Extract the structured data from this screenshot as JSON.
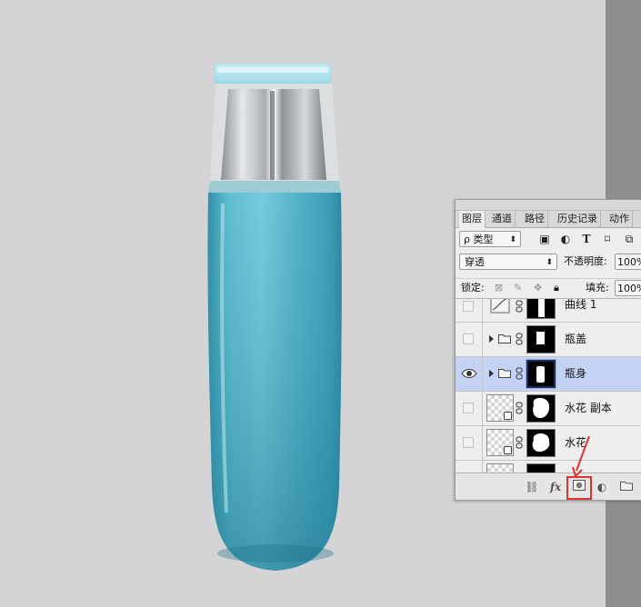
{
  "panel": {
    "tabs": [
      "图层",
      "通道",
      "路径",
      "历史记录",
      "动作"
    ],
    "active_tab": "图层",
    "filter_kind": "ρ 类型",
    "blend_mode": "穿透",
    "opacity_label": "不透明度:",
    "opacity_value": "100%",
    "lock_label": "锁定:",
    "fill_label": "填充:",
    "fill_value": "100%",
    "filter_icons": [
      "image-filter-icon",
      "adjustment-filter-icon",
      "type-filter-icon",
      "shape-filter-icon",
      "smart-object-filter-icon"
    ],
    "layers": [
      {
        "name": "曲线 1",
        "visible": false,
        "selected": false,
        "kind": "adjustment"
      },
      {
        "name": "瓶盖",
        "visible": false,
        "selected": false,
        "kind": "group"
      },
      {
        "name": "瓶身",
        "visible": true,
        "selected": true,
        "kind": "group"
      },
      {
        "name": "水花 副本",
        "visible": false,
        "selected": false,
        "kind": "smart"
      },
      {
        "name": "水花",
        "visible": false,
        "selected": false,
        "kind": "smart"
      }
    ],
    "footer_icons": [
      "link-icon",
      "fx-icon",
      "add-mask-icon",
      "adjustment-layer-icon",
      "new-group-icon"
    ],
    "footer_fx": "fx"
  },
  "colors": {
    "selection": "#c4d3f5",
    "highlight": "#e03232",
    "bottle": "#4fb3c8"
  }
}
